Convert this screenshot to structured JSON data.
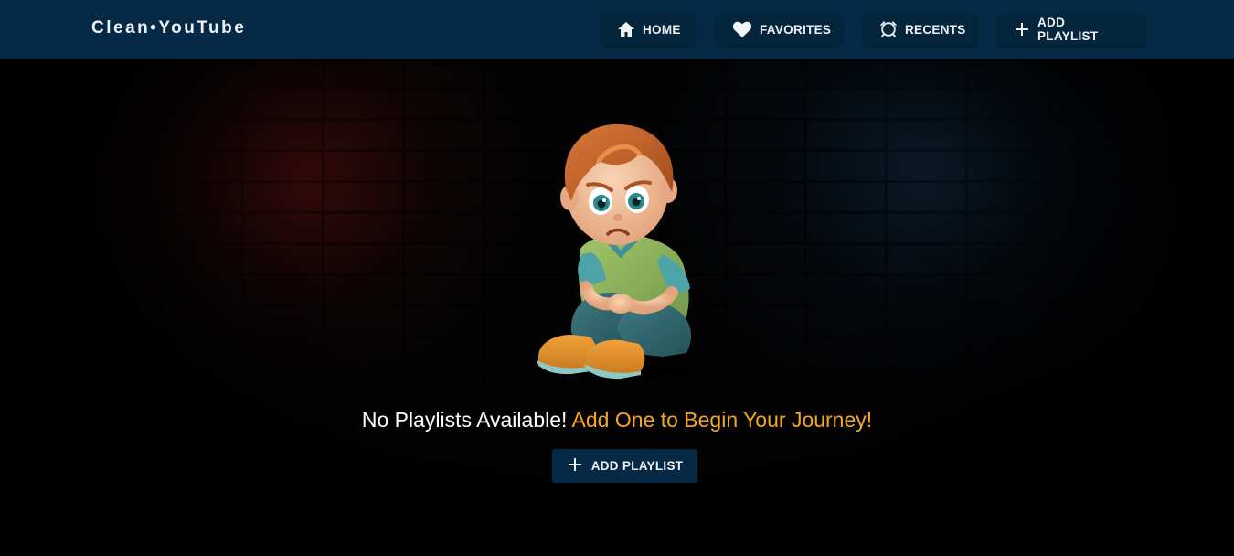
{
  "header": {
    "brand": "Clean•YouTube",
    "nav": {
      "home": {
        "label": "HOME",
        "icon": "home-icon"
      },
      "favorites": {
        "label": "FAVORITES",
        "icon": "heart-icon"
      },
      "recents": {
        "label": "RECENTS",
        "icon": "history-icon"
      },
      "add_playlist": {
        "label": "ADD PLAYLIST",
        "icon": "plus-icon"
      }
    }
  },
  "empty_state": {
    "illustration": "sad-child-illustration",
    "message_primary": "No Playlists Available!",
    "message_accent": "Add One to Begin Your Journey!",
    "cta_label": "ADD PLAYLIST",
    "cta_icon": "plus-icon"
  },
  "colors": {
    "header_bg": "#062a45",
    "accent": "#f5a623",
    "text": "#ffffff"
  }
}
